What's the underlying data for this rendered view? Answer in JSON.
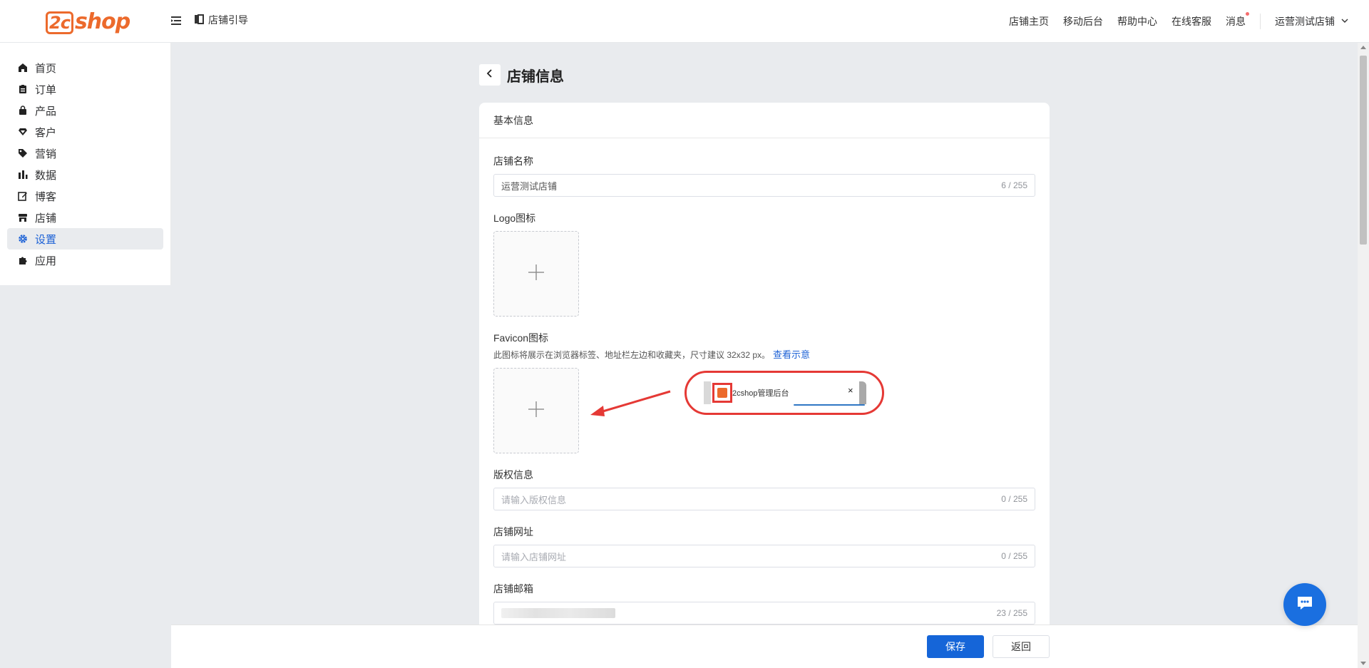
{
  "brand": {
    "logo_text": "shop",
    "logo_badge": "2c"
  },
  "header": {
    "guide_label": "店铺引导",
    "nav": [
      "店铺主页",
      "移动后台",
      "帮助中心",
      "在线客服",
      "消息"
    ],
    "store_name": "运营测试店铺"
  },
  "sidebar": {
    "items": [
      {
        "label": "首页",
        "icon": "home-icon"
      },
      {
        "label": "订单",
        "icon": "clipboard-icon"
      },
      {
        "label": "产品",
        "icon": "bag-icon"
      },
      {
        "label": "客户",
        "icon": "diamond-icon"
      },
      {
        "label": "营销",
        "icon": "tag-icon"
      },
      {
        "label": "数据",
        "icon": "bar-chart-icon"
      },
      {
        "label": "博客",
        "icon": "edit-icon"
      },
      {
        "label": "店铺",
        "icon": "store-icon"
      },
      {
        "label": "设置",
        "icon": "gear-icon",
        "active": true
      },
      {
        "label": "应用",
        "icon": "puzzle-icon"
      }
    ],
    "active_color": "#1d62d6"
  },
  "page": {
    "title": "店铺信息"
  },
  "form": {
    "section_title": "基本信息",
    "store_name": {
      "label": "店铺名称",
      "value": "运营测试店铺",
      "count": "6 / 255"
    },
    "logo": {
      "label": "Logo图标"
    },
    "favicon": {
      "label": "Favicon图标",
      "desc": "此图标将展示在浏览器标签、地址栏左边和收藏夹，尺寸建议 32x32 px。",
      "link": "查看示意",
      "demo_tab_title": "2cshop管理后台",
      "demo_close": "×"
    },
    "copyright": {
      "label": "版权信息",
      "placeholder": "请输入版权信息",
      "count": "0 / 255"
    },
    "url": {
      "label": "店铺网址",
      "placeholder": "请输入店铺网址",
      "count": "0 / 255"
    },
    "email": {
      "label": "店铺邮箱",
      "count": "23 / 255"
    }
  },
  "footer": {
    "save": "保存",
    "back": "返回"
  },
  "colors": {
    "primary": "#1565d8",
    "brand_orange": "#ec6a2c",
    "highlight_red": "#e53935"
  }
}
